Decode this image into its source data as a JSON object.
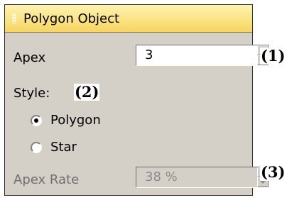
{
  "panel": {
    "title": "Polygon Object",
    "apex": {
      "label": "Apex",
      "value": "3",
      "callout": "(1)"
    },
    "style": {
      "label": "Style:",
      "callout": "(2)",
      "options": [
        {
          "label": "Polygon",
          "selected": true
        },
        {
          "label": "Star",
          "selected": false
        }
      ]
    },
    "apex_rate": {
      "label": "Apex Rate",
      "value": "38 %",
      "enabled": false,
      "callout": "(3)"
    }
  },
  "colors": {
    "title_bar": "#f7d560",
    "panel_bg": "#d4d0c8"
  }
}
